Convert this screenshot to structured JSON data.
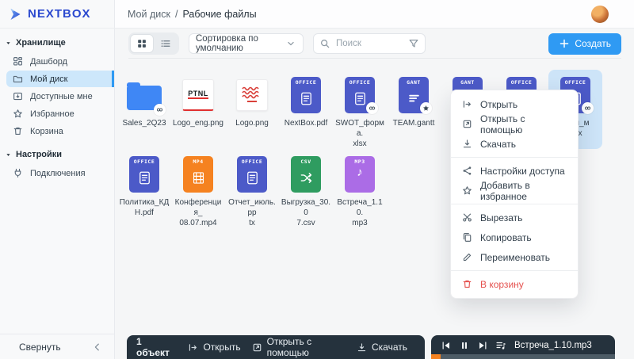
{
  "brand": {
    "name": "NEXTBOX"
  },
  "topbar": {
    "breadcrumb_parent": "Мой диск",
    "breadcrumb_sep": "/",
    "breadcrumb_current": "Рабочие файлы"
  },
  "sidebar": {
    "sections": [
      {
        "label": "Хранилище",
        "items": [
          {
            "label": "Дашборд",
            "icon": "dashboard-icon",
            "active": false
          },
          {
            "label": "Мой диск",
            "icon": "folder-icon",
            "active": true
          },
          {
            "label": "Доступные мне",
            "icon": "shared-icon",
            "active": false
          },
          {
            "label": "Избранное",
            "icon": "star-icon",
            "active": false
          },
          {
            "label": "Корзина",
            "icon": "trash-icon",
            "active": false
          }
        ]
      },
      {
        "label": "Настройки",
        "items": [
          {
            "label": "Подключения",
            "icon": "plug-icon",
            "active": false
          }
        ]
      }
    ],
    "collapse_label": "Свернуть"
  },
  "toolbar": {
    "sort_label": "Сортировка по умолчанию",
    "search_placeholder": "Поиск",
    "create_label": "Создать"
  },
  "files": {
    "rows": [
      [
        {
          "label": "Sales_2Q23",
          "kind": "folder",
          "badge": "link"
        },
        {
          "label": "Logo_eng.png",
          "kind": "image",
          "variant": "ptnl",
          "thumb_text": "PTNL"
        },
        {
          "label": "Logo.png",
          "kind": "image",
          "variant": "waves"
        },
        {
          "label": "NextBox.pdf",
          "kind": "office",
          "chip": "OFFICE"
        },
        {
          "label": "SWOT_форма.\nxlsx",
          "kind": "office",
          "chip": "OFFICE",
          "badge": "link"
        },
        {
          "label": "TEAM.gantt",
          "kind": "gantt",
          "chip": "GANT",
          "badge": "star"
        },
        {
          "label": "",
          "kind": "gantt",
          "chip": "GANT"
        },
        {
          "label": "",
          "kind": "office",
          "chip": "OFFICE"
        },
        {
          "label": "ации_м\nxlsx",
          "kind": "office",
          "chip": "OFFICE",
          "badge": "link",
          "selected": true
        }
      ],
      [
        {
          "label": "Политика_КД\nН.pdf",
          "kind": "office",
          "chip": "OFFICE"
        },
        {
          "label": "Конференция_\n08.07.mp4",
          "kind": "mp4",
          "chip": "MP4"
        },
        {
          "label": "Отчет_июль.pp\ntx",
          "kind": "office",
          "chip": "OFFICE"
        },
        {
          "label": "Выгрузка_30.0\n7.csv",
          "kind": "csv",
          "chip": "CSV"
        },
        {
          "label": "Встреча_1.10.\nmp3",
          "kind": "mp3",
          "chip": "MP3"
        }
      ]
    ]
  },
  "context_menu": {
    "items": [
      {
        "label": "Открыть",
        "icon": "open-icon"
      },
      {
        "label": "Открыть с помощью",
        "icon": "open-with-icon"
      },
      {
        "label": "Скачать",
        "icon": "download-icon",
        "divider_after": true
      },
      {
        "label": "Настройки доступа",
        "icon": "share-icon"
      },
      {
        "label": "Добавить в избранное",
        "icon": "star-icon",
        "divider_after": true
      },
      {
        "label": "Вырезать",
        "icon": "cut-icon"
      },
      {
        "label": "Копировать",
        "icon": "copy-icon"
      },
      {
        "label": "Переименовать",
        "icon": "rename-icon",
        "divider_after": true
      },
      {
        "label": "В корзину",
        "icon": "trash-icon",
        "danger": true
      }
    ]
  },
  "selection_bar": {
    "count": "1 объект",
    "actions": [
      {
        "label": "Открыть",
        "icon": "open-icon"
      },
      {
        "label": "Открыть с помощью",
        "icon": "open-with-icon"
      },
      {
        "label": "Скачать",
        "icon": "download-icon"
      }
    ]
  },
  "player_bar": {
    "track": "Встреча_1.10.mp3",
    "progress_percent": 5
  },
  "colors": {
    "accent": "#2f9af3",
    "danger": "#e5524f",
    "bar_bg": "#25323d",
    "progress": "#f58220",
    "folder": "#3f87f5",
    "office": "#4c5ac8",
    "gantt": "#4c5ac8",
    "mp4": "#f58220",
    "csv": "#2f9c60",
    "mp3": "#ab6ce6"
  }
}
